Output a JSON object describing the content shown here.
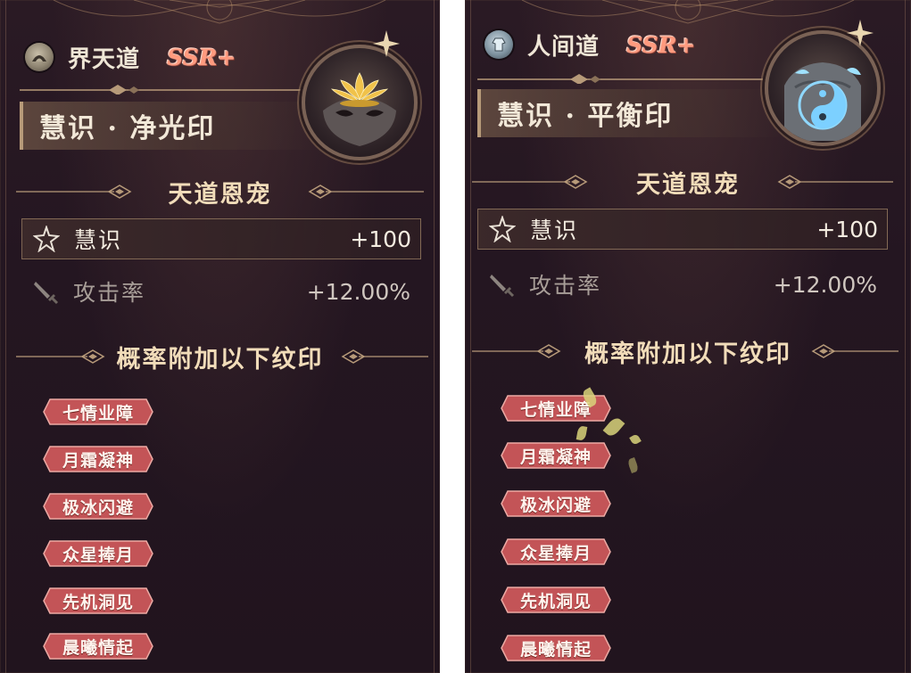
{
  "panels": [
    {
      "type_name": "界天道",
      "rarity": "SSR+",
      "seal_name": "慧识 · 净光印",
      "emblem_icon": "lotus-mask-icon",
      "favor_title": "天道恩宠",
      "stats": [
        {
          "icon": "star-gear-icon",
          "label": "慧识",
          "value": "+100"
        },
        {
          "icon": "sword-icon",
          "label": "攻击率",
          "value": "+12.00%"
        }
      ],
      "extra_title": "概率附加以下纹印",
      "marks": [
        "七情业障",
        "月霜凝神",
        "极冰闪避",
        "众星捧月",
        "先机洞见",
        "晨曦情起"
      ]
    },
    {
      "type_name": "人间道",
      "rarity": "SSR+",
      "seal_name": "慧识 · 平衡印",
      "emblem_icon": "yin-yang-torso-icon",
      "favor_title": "天道恩宠",
      "stats": [
        {
          "icon": "star-gear-icon",
          "label": "慧识",
          "value": "+100"
        },
        {
          "icon": "sword-icon",
          "label": "攻击率",
          "value": "+12.00%"
        }
      ],
      "extra_title": "概率附加以下纹印",
      "marks": [
        "七情业障",
        "月霜凝神",
        "极冰闪避",
        "众星捧月",
        "先机洞见",
        "晨曦情起"
      ]
    }
  ],
  "colors": {
    "background": "#23151f",
    "title_gold": "#f1dcb9",
    "rarity_pink": "#ff9a7e",
    "tag_red": "#c9555a",
    "frame_bronze": "#b79a79"
  }
}
